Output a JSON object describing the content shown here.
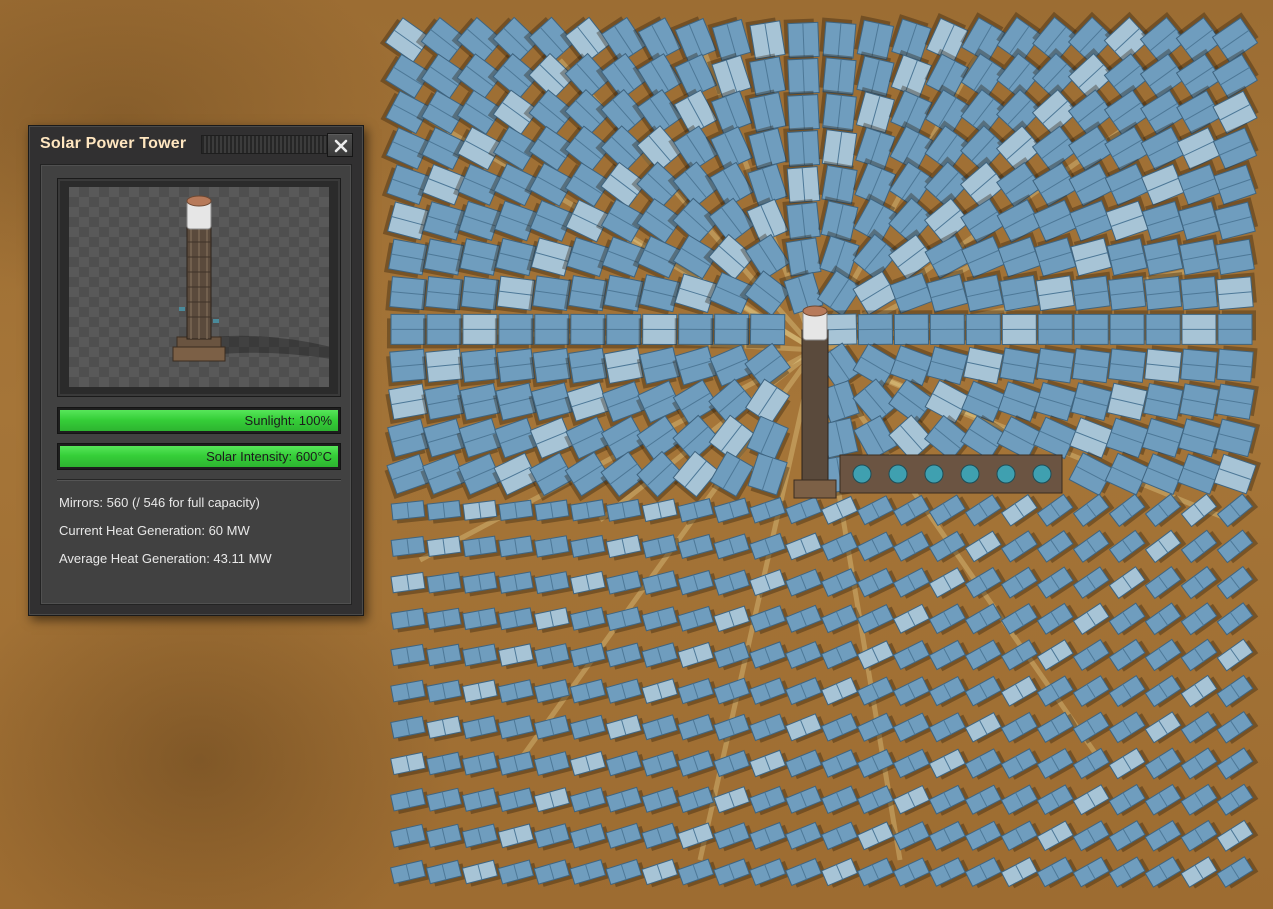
{
  "window": {
    "title": "Solar Power Tower",
    "close_icon": "close-x-icon"
  },
  "bars": {
    "sunlight": {
      "label": "Sunlight: 100%",
      "level": 1.0,
      "color": "#3ad13d"
    },
    "intensity": {
      "label": "Solar Intensity: 600°C",
      "level": 1.0,
      "color": "#3ad13d"
    }
  },
  "stats": {
    "mirrors": "Mirrors: 560 (/ 546 for full capacity)",
    "current_heat": "Current Heat Generation: 60 MW",
    "average_heat": "Average Heat Generation: 43.11 MW"
  },
  "colors": {
    "title_text": "#ffe6c0",
    "panel_bg": "#313031",
    "mirror": "#6d9bbd",
    "ground": "#a57538"
  }
}
